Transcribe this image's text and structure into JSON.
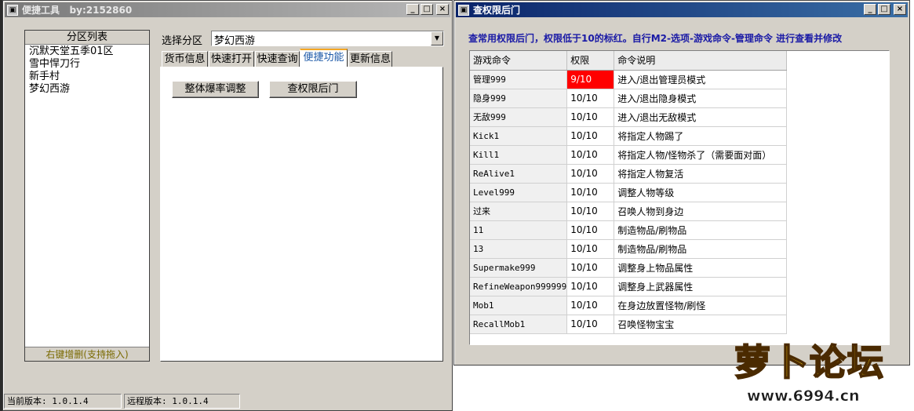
{
  "left_window": {
    "title": "便捷工具   by:2152860",
    "zone_list_header": "分区列表",
    "zones": [
      "沉默天堂五季01区",
      "雪中悍刀行",
      "新手村",
      "梦幻西游"
    ],
    "zone_list_footer": "右键增删(支持拖入)",
    "select_zone_label": "选择分区",
    "select_zone_value": "梦幻西游",
    "tabs": [
      "货币信息",
      "快速打开",
      "快速查询",
      "便捷功能",
      "更新信息"
    ],
    "active_tab": "便捷功能",
    "btn_adjust_rate": "整体爆率调整",
    "btn_check_backdoor": "查权限后门",
    "status_local": "当前版本: 1.0.1.4",
    "status_remote": "远程版本: 1.0.1.4"
  },
  "right_window": {
    "title": "查权限后门",
    "notice": "查常用权限后门，权限低于10的标红。自行M2-选项-游戏命令-管理命令 进行查看并修改",
    "columns": [
      "游戏命令",
      "权限",
      "命令说明"
    ],
    "rows": [
      {
        "cmd": "管理999",
        "perm": "9/10",
        "desc": "进入/退出管理员模式",
        "highlight": true
      },
      {
        "cmd": "隐身999",
        "perm": "10/10",
        "desc": "进入/退出隐身模式",
        "highlight": false
      },
      {
        "cmd": "无敌999",
        "perm": "10/10",
        "desc": "进入/退出无敌模式",
        "highlight": false
      },
      {
        "cmd": "Kick1",
        "perm": "10/10",
        "desc": "将指定人物踢了",
        "highlight": false
      },
      {
        "cmd": "Kill1",
        "perm": "10/10",
        "desc": "将指定人物/怪物杀了（需要面对面）",
        "highlight": false
      },
      {
        "cmd": "ReAlive1",
        "perm": "10/10",
        "desc": "将指定人物复活",
        "highlight": false
      },
      {
        "cmd": "Level999",
        "perm": "10/10",
        "desc": "调整人物等级",
        "highlight": false
      },
      {
        "cmd": "过来",
        "perm": "10/10",
        "desc": "召唤人物到身边",
        "highlight": false
      },
      {
        "cmd": "11",
        "perm": "10/10",
        "desc": "制造物品/刷物品",
        "highlight": false
      },
      {
        "cmd": "13",
        "perm": "10/10",
        "desc": "制造物品/刷物品",
        "highlight": false
      },
      {
        "cmd": "Supermake999",
        "perm": "10/10",
        "desc": "调整身上物品属性",
        "highlight": false
      },
      {
        "cmd": "RefineWeapon999999",
        "perm": "10/10",
        "desc": "调整身上武器属性",
        "highlight": false
      },
      {
        "cmd": "Mob1",
        "perm": "10/10",
        "desc": "在身边放置怪物/刷怪",
        "highlight": false
      },
      {
        "cmd": "RecallMob1",
        "perm": "10/10",
        "desc": "召唤怪物宝宝",
        "highlight": false
      }
    ]
  },
  "watermark": {
    "logo_text": "萝卜论坛",
    "url": "www.6994.cn"
  },
  "colors": {
    "notice_text": "#1a1aa6",
    "highlight_red": "#ff0000",
    "active_tab_text": "#1e5aa8",
    "zone_footer_text": "#7a6a00"
  }
}
